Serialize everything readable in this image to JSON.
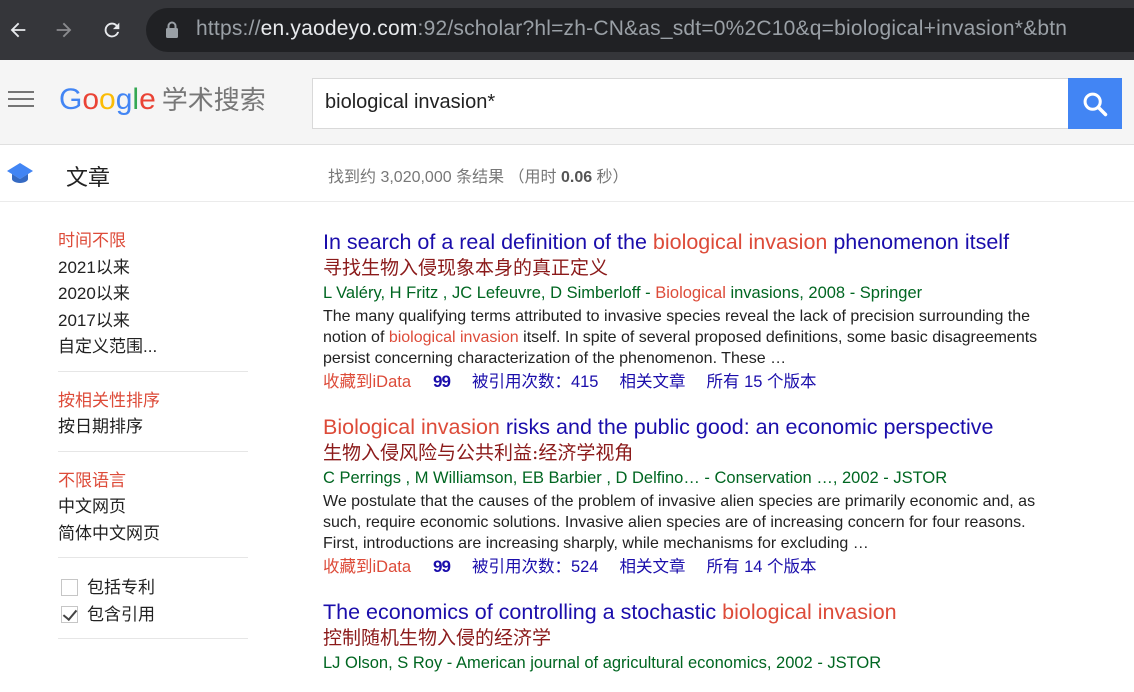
{
  "browser": {
    "url_prefix": "https://",
    "url_host": "en.yaodeyo.com",
    "url_rest": ":92/scholar?hl=zh-CN&as_sdt=0%2C10&q=biological+invasion*&btn"
  },
  "header": {
    "logo_letters": [
      "G",
      "o",
      "o",
      "g",
      "l",
      "e"
    ],
    "logo_sub": "学术搜索",
    "search_value": "biological invasion*"
  },
  "subheader": {
    "section": "文章",
    "stats_prefix": "找到约 3,020,000 条结果 （用时 ",
    "stats_time": "0.06",
    "stats_suffix": " 秒）"
  },
  "sidebar": {
    "time": [
      "时间不限",
      "2021以来",
      "2020以来",
      "2017以来",
      "自定义范围..."
    ],
    "sort": [
      "按相关性排序",
      "按日期排序"
    ],
    "lang": [
      "不限语言",
      "中文网页",
      "简体中文网页"
    ],
    "patents": "包括专利",
    "citations": "包含引用"
  },
  "colors": {
    "link": "#1a0dab",
    "highlight": "#dd4b39",
    "meta": "#006621",
    "search_button": "#4285f4"
  },
  "results": [
    {
      "title_a": "In search of a real definition of the ",
      "title_hl": "biological invasion",
      "title_b": " phenomenon itself",
      "translation": "寻找生物入侵现象本身的真正定义",
      "meta_a": "L Valéry, H Fritz , JC Lefeuvre, D Simberloff - ",
      "meta_hl": "Biological",
      "meta_b": " invasions, 2008 - Springer",
      "snippet_a": "The many qualifying terms attributed to invasive species reveal the lack of precision surrounding the notion of ",
      "snippet_hl": "biological invasion",
      "snippet_b": " itself. In spite of several proposed definitions, some basic disagreements persist concerning characterization of the phenomenon. These …",
      "save": "收藏到iData",
      "cite": "99",
      "cited_by": "被引用次数：415",
      "related": "相关文章",
      "versions": "所有 15 个版本"
    },
    {
      "title_a": "",
      "title_hl": "Biological invasion",
      "title_b": " risks and the public good: an economic perspective",
      "translation": "生物入侵风险与公共利益:经济学视角",
      "meta_a": "C Perrings , M Williamson, EB Barbier , D Delfino… - Conservation …, 2002 - JSTOR",
      "meta_hl": "",
      "meta_b": "",
      "snippet_a": "We postulate that the causes of the problem of invasive alien species are primarily economic and, as such, require economic solutions. Invasive alien species are of increasing concern for four reasons. First, introductions are increasing sharply, while mechanisms for excluding …",
      "snippet_hl": "",
      "snippet_b": "",
      "save": "收藏到iData",
      "cite": "99",
      "cited_by": "被引用次数：524",
      "related": "相关文章",
      "versions": "所有 14 个版本"
    },
    {
      "title_a": "The economics of controlling a stochastic ",
      "title_hl": "biological invasion",
      "title_b": "",
      "translation": "控制随机生物入侵的经济学",
      "meta_a": "LJ Olson, S Roy - American journal of agricultural economics, 2002 - JSTOR",
      "meta_hl": "",
      "meta_b": ""
    }
  ]
}
